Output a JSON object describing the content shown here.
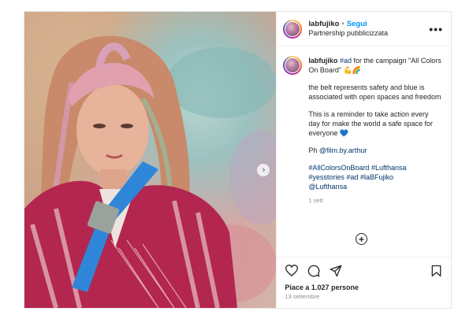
{
  "header": {
    "username": "labfujiko",
    "separator": "•",
    "follow_label": "Segui",
    "subtitle": "Partnership pubblicizzata",
    "more_label": "•••"
  },
  "media": {
    "next_label": "›"
  },
  "caption": {
    "username": "labfujiko",
    "tag_ad": "#ad",
    "line1_rest": " for the campaign \"All Colors On Board\" 💪🌈",
    "para2": "the belt represents safety and blue is associated with open spaces and freedom",
    "para3": "This is a reminder to take action every day for make the world a safe space for everyone 💙",
    "ph_label": "Ph ",
    "ph_mention": "@film.by.arthur",
    "hashtags": "#AllColorsOnBoard #Lufthansa #yesstories #ad #laBFujiko",
    "mention_lufthansa": "@Lufthansa",
    "time": "1 sett"
  },
  "add_comment_label": "+",
  "likes": "Piace a 1.027 persone",
  "date": "13 settembre",
  "colors": {
    "link": "#0095f6",
    "tag": "#00376b",
    "muted": "#8e8e8e"
  },
  "icons": [
    "heart-icon",
    "comment-icon",
    "share-icon",
    "bookmark-icon",
    "add-comment-icon",
    "more-icon",
    "chevron-right-icon"
  ]
}
